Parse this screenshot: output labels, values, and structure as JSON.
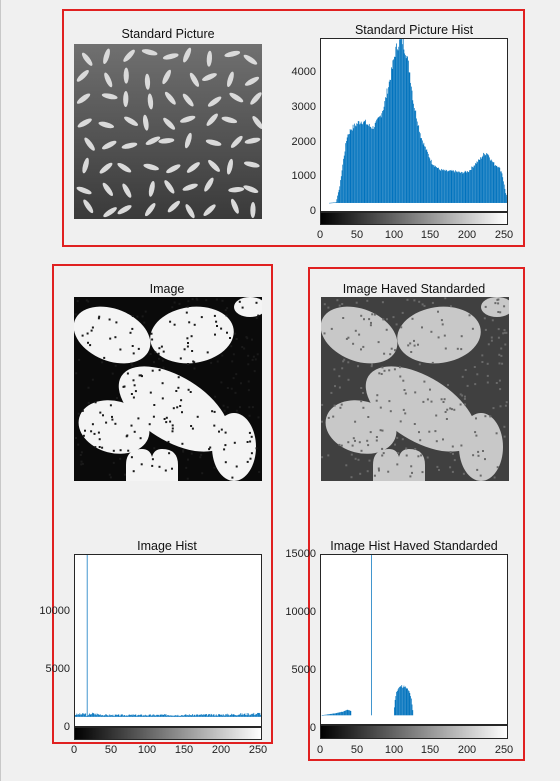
{
  "accent_colors": {
    "highlight_box": "#e02020",
    "histogram": "#0072bd"
  },
  "panels": {
    "standard_picture": {
      "title": "Standard Picture"
    },
    "standard_hist": {
      "title": "Standard Picture Hist",
      "y_ticks": [
        "0",
        "1000",
        "2000",
        "3000",
        "4000"
      ],
      "x_ticks": [
        "0",
        "50",
        "100",
        "150",
        "200",
        "250"
      ]
    },
    "image": {
      "title": "Image"
    },
    "image_standardized": {
      "title": "Image Haved Standarded"
    },
    "image_hist": {
      "title": "Image Hist",
      "y_ticks": [
        "0",
        "5000",
        "10000"
      ],
      "x_ticks": [
        "0",
        "50",
        "100",
        "150",
        "200",
        "250"
      ]
    },
    "image_hist_standardized": {
      "title": "Image Hist Haved Standarded",
      "y_ticks": [
        "0",
        "5000",
        "10000",
        "15000"
      ],
      "x_ticks": [
        "0",
        "50",
        "100",
        "150",
        "200",
        "250"
      ]
    }
  },
  "chart_data": [
    {
      "type": "bar",
      "title": "Standard Picture Hist",
      "xlim": [
        0,
        255
      ],
      "ylim": [
        -300,
        4900
      ],
      "x": [
        0,
        10,
        20,
        25,
        30,
        35,
        40,
        45,
        50,
        55,
        60,
        65,
        70,
        75,
        80,
        85,
        90,
        95,
        100,
        105,
        110,
        115,
        120,
        125,
        130,
        135,
        140,
        150,
        160,
        170,
        180,
        190,
        200,
        210,
        215,
        220,
        225,
        230,
        235,
        240,
        245,
        250,
        255
      ],
      "values": [
        0,
        0,
        20,
        500,
        1300,
        2000,
        2200,
        2300,
        2400,
        2450,
        2400,
        2300,
        2250,
        2400,
        2600,
        2900,
        3400,
        3900,
        4500,
        4800,
        4850,
        4500,
        3900,
        3000,
        2500,
        2000,
        1700,
        1200,
        1000,
        950,
        950,
        900,
        950,
        1200,
        1300,
        1450,
        1500,
        1300,
        1150,
        1100,
        900,
        300,
        0
      ]
    },
    {
      "type": "bar",
      "title": "Image Hist",
      "xlim": [
        0,
        255
      ],
      "ylim": [
        -1000,
        14500
      ],
      "x": [
        0,
        5,
        10,
        14,
        16,
        20,
        40,
        60,
        80,
        100,
        120,
        140,
        160,
        180,
        200,
        220,
        240,
        250,
        254,
        255
      ],
      "values": [
        200,
        220,
        240,
        260,
        14500,
        300,
        160,
        150,
        160,
        150,
        170,
        160,
        170,
        180,
        190,
        220,
        260,
        300,
        320,
        14500
      ]
    },
    {
      "type": "bar",
      "title": "Image Hist Haved Standarded",
      "xlim": [
        0,
        255
      ],
      "ylim": [
        -1000,
        15000
      ],
      "x": [
        0,
        20,
        30,
        35,
        68,
        98,
        100,
        103,
        105,
        108,
        110,
        113,
        115,
        118,
        120,
        122,
        125,
        255
      ],
      "values": [
        0,
        200,
        350,
        500,
        15000,
        0,
        1500,
        2400,
        2600,
        2700,
        2650,
        2700,
        2600,
        2400,
        2000,
        1500,
        0,
        15000
      ]
    }
  ]
}
